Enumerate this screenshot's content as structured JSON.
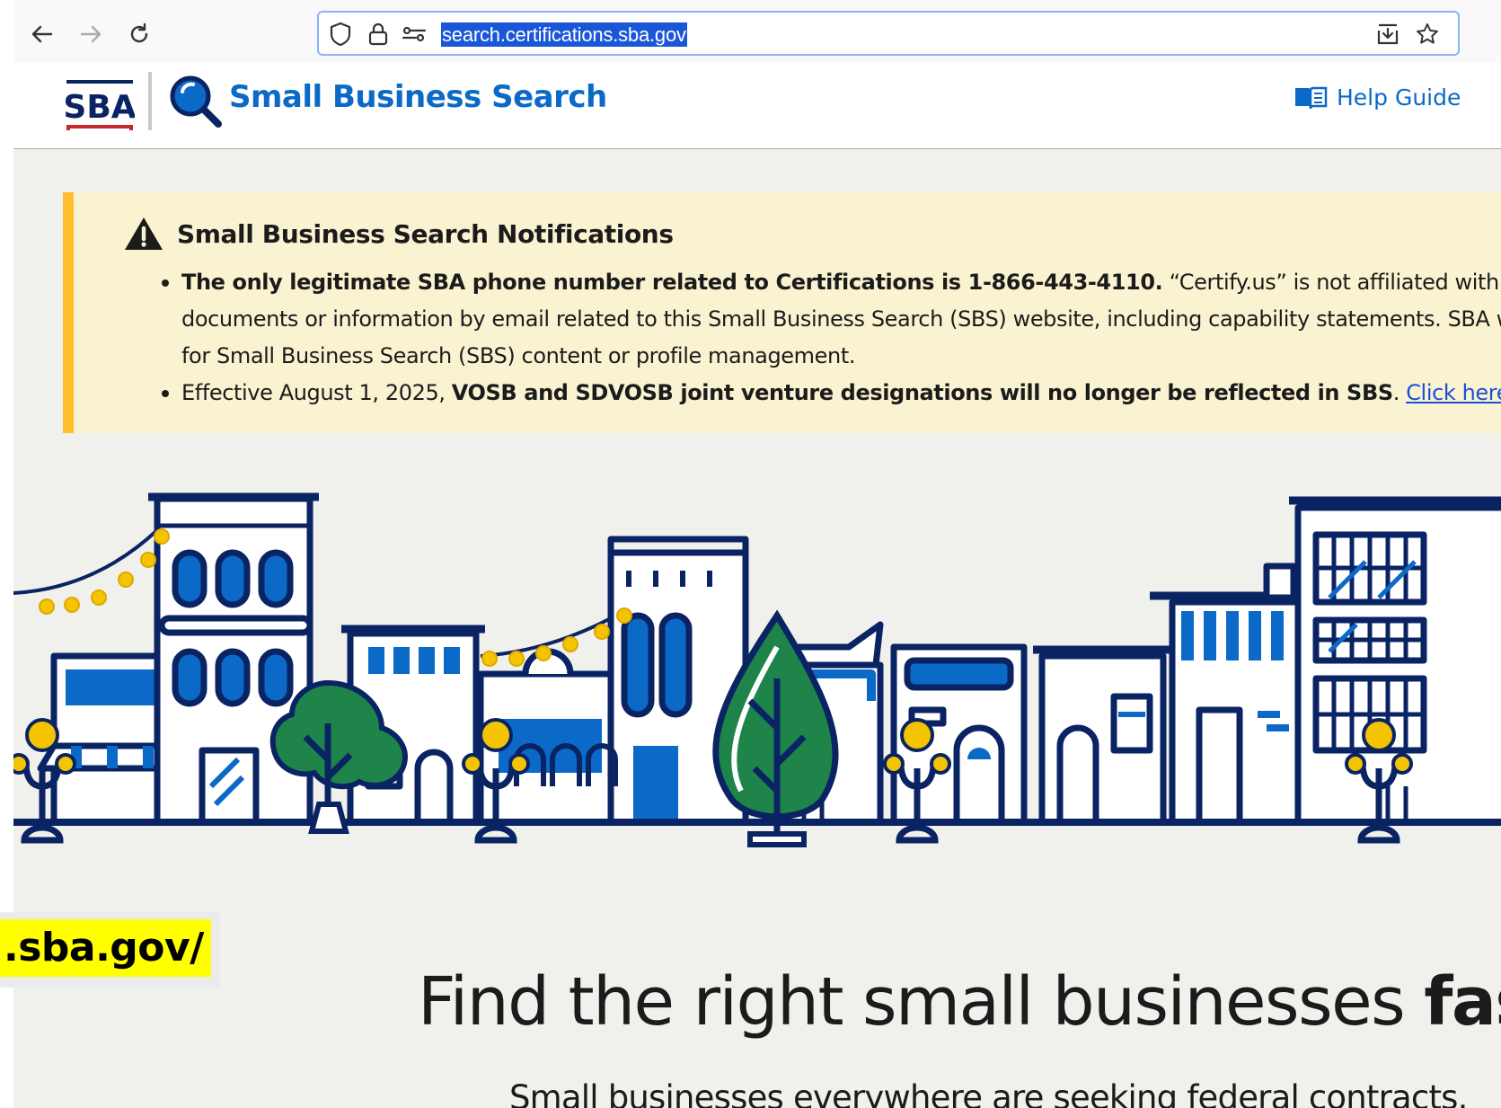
{
  "browser": {
    "url": "search.certifications.sba.gov"
  },
  "header": {
    "logo_text": "SBA",
    "title": "Small Business Search",
    "help_label": "Help Guide"
  },
  "notice": {
    "title": "Small Business Search Notifications",
    "item1": {
      "bold": "The only legitimate SBA phone number related to Certifications is 1-866-443-4110.",
      "text": " “Certify.us” is not affiliated with SBA. S",
      "line2": "documents or information by email related to this Small Business Search (SBS) website, including capability statements. SBA w",
      "line3": "for Small Business Search (SBS) content or profile management."
    },
    "item2": {
      "text": "Effective August 1, 2025, ",
      "bold": "VOSB and SDVOSB joint venture designations will no longer be reflected in SBS",
      "period": ". ",
      "link": "Click here to learn"
    }
  },
  "hero": {
    "title_regular": "Find the right small businesses ",
    "title_bold": "fast",
    "title_end": ".",
    "subtitle": "Small businesses everywhere are seeking federal contracts."
  },
  "overlay": {
    "tag": ".sba.gov/"
  },
  "colors": {
    "brand_blue": "#0b69c7",
    "navy": "#0a2463",
    "notice_bg": "#faf3d1",
    "notice_border": "#ffbe2e",
    "tree_green": "#1e8449",
    "bulb_yellow": "#f5c400",
    "highlight": "#ffff00"
  }
}
